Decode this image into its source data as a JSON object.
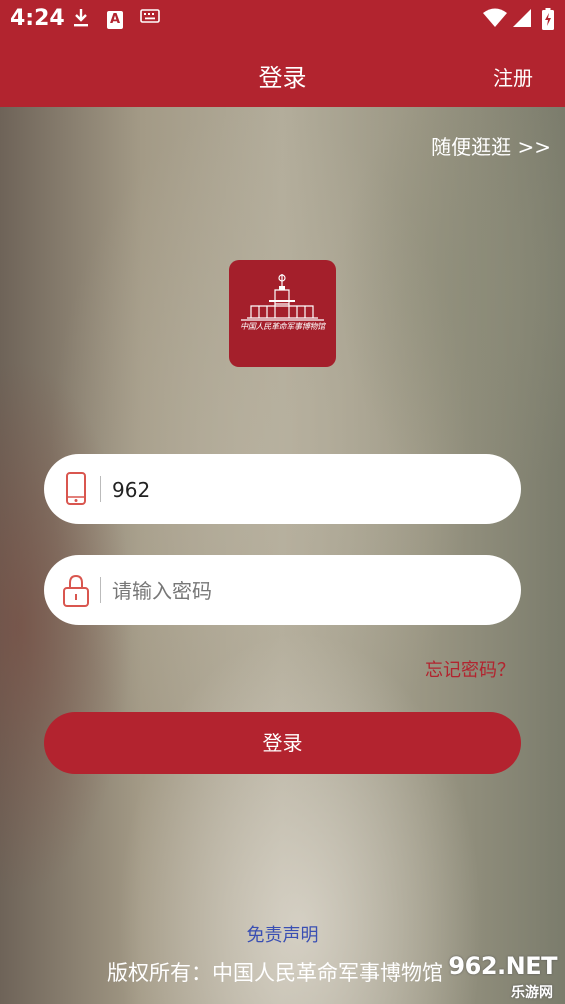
{
  "status_bar": {
    "time": "4:24",
    "download_icon": "download-icon",
    "font_icon_text": "A",
    "keyboard_icon": "keyboard-icon",
    "wifi_icon": "wifi-icon",
    "signal_icon": "signal-icon",
    "battery_icon": "battery-icon"
  },
  "header": {
    "title": "登录",
    "register_label": "注册"
  },
  "browse_link": "随便逛逛 >>",
  "logo": {
    "text": "中国人民革命军事博物馆"
  },
  "form": {
    "phone": {
      "value": "962",
      "icon": "phone-icon"
    },
    "password": {
      "placeholder": "请输入密码",
      "icon": "lock-icon"
    },
    "forgot_password": "忘记密码？",
    "login_label": "登录"
  },
  "footer": {
    "disclaimer": "免责声明",
    "copyright": "版权所有：中国人民革命军事博物馆"
  },
  "watermark": {
    "main": "962.NET",
    "sub": "乐游网"
  },
  "colors": {
    "brand_red": "#b2242f",
    "link_blue": "#3a4fb3"
  }
}
